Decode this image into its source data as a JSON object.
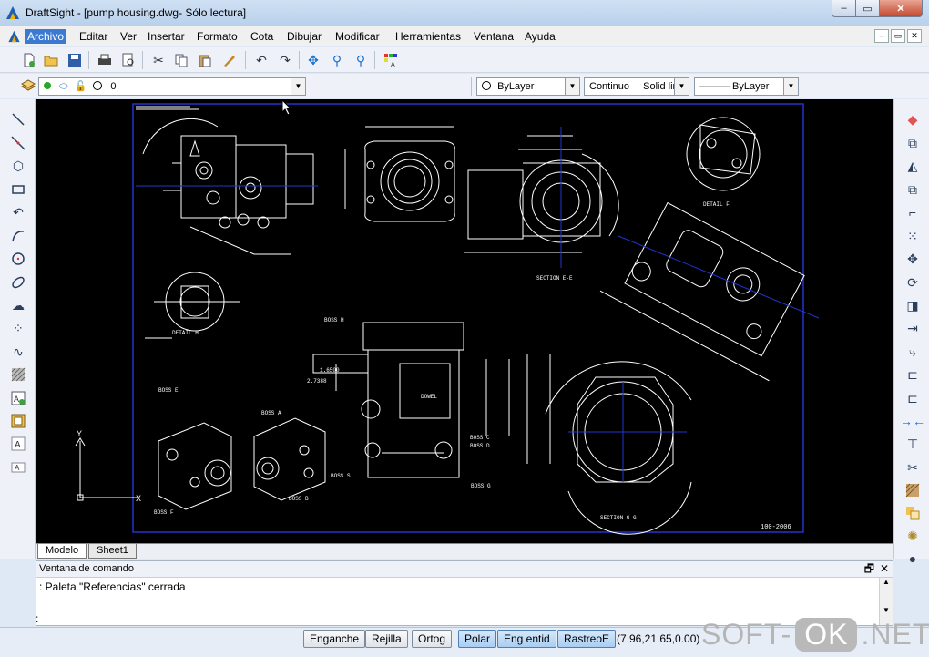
{
  "window": {
    "title": "DraftSight - [pump housing.dwg- Sólo lectura]",
    "min_glyph": "–",
    "max_glyph": "▭",
    "close_glyph": "✕"
  },
  "menu": {
    "items": [
      "Archivo",
      "Editar",
      "Ver",
      "Insertar",
      "Formato",
      "Cota",
      "Dibujar",
      "Modificar",
      "Herramientas",
      "Ventana",
      "Ayuda"
    ],
    "active": "Archivo",
    "mdi_min": "–",
    "mdi_restore": "▭",
    "mdi_close": "✕"
  },
  "toolbar": {
    "icons": [
      "new-file-icon",
      "open-folder-icon",
      "save-icon",
      "print-icon",
      "print-preview-icon",
      "cut-icon",
      "copy-icon",
      "paste-icon",
      "match-properties-icon",
      "undo-icon",
      "redo-icon",
      "pan-icon",
      "zoom-window-icon",
      "zoom-previous-icon",
      "properties-palette-icon"
    ]
  },
  "layers": {
    "current_layer": "0",
    "color": "ByLayer",
    "linetype": "Continuo",
    "linetype_desc": "Solid line",
    "lineweight": "——— ByLayer"
  },
  "left_tools": [
    "line-icon",
    "infinite-line-icon",
    "polygon-icon",
    "rectangle-icon",
    "arc-icon",
    "spline-icon",
    "circle-icon",
    "ellipse-icon",
    "revision-cloud-icon",
    "points-icon",
    "freehand-icon",
    "hatch-icon",
    "insert-block-icon",
    "make-block-icon",
    "text-icon",
    "simple-note-icon"
  ],
  "right_tools": [
    "erase-icon",
    "copy-entity-icon",
    "mirror-icon",
    "offset-icon",
    "pattern-icon",
    "array-icon",
    "move-icon",
    "rotate-icon",
    "scale-icon",
    "stretch-icon",
    "trim-icon",
    "extend-icon",
    "fillet-icon",
    "chamfer-icon",
    "join-icon",
    "break-icon",
    "explode-icon",
    "edit-hatch-icon",
    "order-icon",
    "pan-icon",
    "bomb-icon"
  ],
  "drawing": {
    "labels": [
      "BOSS H",
      "BOSS E",
      "BOSS A",
      "BOSS B",
      "BOSS C",
      "BOSS D",
      "BOSS F",
      "BOSS G",
      "BOSS S",
      "DETAIL H",
      "DETAIL F",
      "SECTION E-E",
      "SECTION G-G",
      "2.7388",
      "1.6500",
      "DOWEL",
      "100-2006"
    ]
  },
  "sheets": {
    "model": "Modelo",
    "sheet1": "Sheet1"
  },
  "command": {
    "title": "Ventana de comando",
    "history": ": Paleta \"Referencias\" cerrada",
    "prompt": ":",
    "float_glyph": "🗗",
    "close_glyph": "✕"
  },
  "status": {
    "buttons": [
      {
        "label": "Enganche",
        "on": false
      },
      {
        "label": "Rejilla",
        "on": false
      },
      {
        "label": "Ortog",
        "on": false
      },
      {
        "label": "Polar",
        "on": true
      },
      {
        "label": "Eng entid",
        "on": true
      },
      {
        "label": "RastreoE",
        "on": true
      }
    ],
    "coords": "(7.96,21.65,0.00)"
  },
  "watermark": {
    "left": "SOFT-",
    "mid": "OK",
    "right": ".NET"
  }
}
